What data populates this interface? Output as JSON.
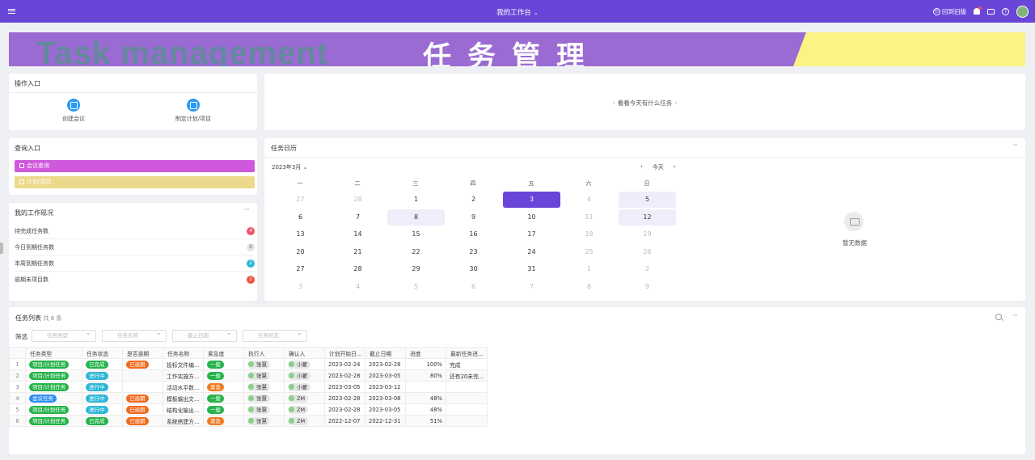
{
  "topbar": {
    "title": "我的工作台",
    "return_label": "回到旧版",
    "return_glyph": "©",
    "chevron": "⌄",
    "help_glyph": "?"
  },
  "banner": {
    "en_text": "Task management",
    "cn_text": "任务管理"
  },
  "ops": {
    "title": "操作入口",
    "items": [
      {
        "label": "创建会议"
      },
      {
        "label": "制定计划/项目"
      }
    ]
  },
  "today": {
    "text": "◦ 看看今天有什么任务 ◦"
  },
  "query": {
    "title": "查询入口",
    "items": [
      {
        "label": "会议查询",
        "color": "#cf59dd"
      },
      {
        "label": "计划/项目",
        "color": "#ecd98b"
      }
    ]
  },
  "workstatus": {
    "title": "我的工作现况",
    "rows": [
      {
        "label": "待完成任务数",
        "count": "4",
        "color": "#f0526a"
      },
      {
        "label": "今日到期任务数",
        "count": "0",
        "color": "#e4e4e4"
      },
      {
        "label": "本周到期任务数",
        "count": "2",
        "color": "#2bb7d6"
      },
      {
        "label": "逾期未项目数",
        "count": "2",
        "color": "#f0513e"
      }
    ]
  },
  "calendar": {
    "title": "任务日历",
    "month": "2023年3月",
    "month_chevron": "⌄",
    "prev_arrow": "‹",
    "next_arrow": "›",
    "today_label": "今天",
    "weekdays": [
      "一",
      "二",
      "三",
      "四",
      "五",
      "六",
      "日"
    ],
    "weeks": [
      [
        [
          "27",
          "o"
        ],
        [
          "28",
          "o"
        ],
        [
          "1",
          ""
        ],
        [
          "2",
          ""
        ],
        [
          "3",
          "today"
        ],
        [
          "4",
          "o"
        ],
        [
          "5",
          "wkd"
        ]
      ],
      [
        [
          "6",
          ""
        ],
        [
          "7",
          ""
        ],
        [
          "8",
          "wkd"
        ],
        [
          "9",
          ""
        ],
        [
          "10",
          ""
        ],
        [
          "11",
          "o"
        ],
        [
          "12",
          "wkd"
        ]
      ],
      [
        [
          "13",
          ""
        ],
        [
          "14",
          ""
        ],
        [
          "15",
          ""
        ],
        [
          "16",
          ""
        ],
        [
          "17",
          ""
        ],
        [
          "18",
          "o"
        ],
        [
          "19",
          "o"
        ]
      ],
      [
        [
          "20",
          ""
        ],
        [
          "21",
          ""
        ],
        [
          "22",
          ""
        ],
        [
          "23",
          ""
        ],
        [
          "24",
          ""
        ],
        [
          "25",
          "o"
        ],
        [
          "26",
          "o"
        ]
      ],
      [
        [
          "27",
          ""
        ],
        [
          "28",
          ""
        ],
        [
          "29",
          ""
        ],
        [
          "30",
          ""
        ],
        [
          "31",
          ""
        ],
        [
          "1",
          "o"
        ],
        [
          "2",
          "o"
        ]
      ],
      [
        [
          "3",
          "o"
        ],
        [
          "4",
          "o"
        ],
        [
          "5",
          "o"
        ],
        [
          "6",
          "o"
        ],
        [
          "7",
          "o"
        ],
        [
          "8",
          "o"
        ],
        [
          "9",
          "o"
        ]
      ]
    ],
    "empty_text": "暂无数据"
  },
  "tasklist": {
    "title": "任务列表",
    "count_text": "共 6 条",
    "filter_label": "筛选",
    "filters": [
      "任务类型",
      "任务名称",
      "截止日期",
      "任务状态"
    ],
    "columns": [
      "任务类型",
      "任务状态",
      "是否逾期",
      "任务名称",
      "紧急度",
      "执行人",
      "确认人",
      "计划开始日...",
      "截止日期",
      "进度",
      "最新任务进..."
    ],
    "rows": [
      {
        "n": "1",
        "type": "项目/计划任务",
        "type_c": "#26b34a",
        "status": "已完成",
        "status_c": "#26b34a",
        "overdue": "已逾期",
        "name": "投标文件编...",
        "urg": "一般",
        "urg_c": "#26b34a",
        "exec": "张慧",
        "exec_c": "#8ccf8a",
        "conf": "小翟",
        "conf_c": "#8ccf8a",
        "start": "2023-02-24",
        "end": "2023-02-28",
        "prog": "100%",
        "latest": "完成"
      },
      {
        "n": "2",
        "type": "项目/计划任务",
        "type_c": "#26b34a",
        "status": "进行中",
        "status_c": "#2bb7d6",
        "overdue": "",
        "name": "工作实施方...",
        "urg": "一般",
        "urg_c": "#26b34a",
        "exec": "张慧",
        "exec_c": "#8ccf8a",
        "conf": "小翟",
        "conf_c": "#8ccf8a",
        "start": "2023-02-28",
        "end": "2023-03-05",
        "prog": "80%",
        "latest": "还有20未完..."
      },
      {
        "n": "3",
        "type": "项目/计划任务",
        "type_c": "#26b34a",
        "status": "进行中",
        "status_c": "#2bb7d6",
        "overdue": "",
        "name": "活动水平数...",
        "urg": "紧急",
        "urg_c": "#f07a20",
        "exec": "张慧",
        "exec_c": "#8ccf8a",
        "conf": "小翟",
        "conf_c": "#8ccf8a",
        "start": "2023-03-05",
        "end": "2023-03-12",
        "prog": "",
        "latest": ""
      },
      {
        "n": "4",
        "type": "会议任务",
        "type_c": "#2d8ff2",
        "status": "进行中",
        "status_c": "#2bb7d6",
        "overdue": "已逾期",
        "name": "模板输出文...",
        "urg": "一般",
        "urg_c": "#26b34a",
        "exec": "张慧",
        "exec_c": "#8ccf8a",
        "conf": "ZM",
        "conf_c": "#8ccf8a",
        "start": "2023-02-28",
        "end": "2023-03-08",
        "prog": "48%",
        "latest": ""
      },
      {
        "n": "5",
        "type": "项目/计划任务",
        "type_c": "#26b34a",
        "status": "进行中",
        "status_c": "#2bb7d6",
        "overdue": "已逾期",
        "name": "结构化输出...",
        "urg": "一般",
        "urg_c": "#26b34a",
        "exec": "张慧",
        "exec_c": "#8ccf8a",
        "conf": "ZM",
        "conf_c": "#8ccf8a",
        "start": "2023-02-28",
        "end": "2023-03-05",
        "prog": "48%",
        "latest": ""
      },
      {
        "n": "6",
        "type": "项目/计划任务",
        "type_c": "#26b34a",
        "status": "已完成",
        "status_c": "#26b34a",
        "overdue": "已逾期",
        "name": "系统搭建方...",
        "urg": "紧急",
        "urg_c": "#f07a20",
        "exec": "张慧",
        "exec_c": "#8ccf8a",
        "conf": "ZM",
        "conf_c": "#8ccf8a",
        "start": "2022-12-07",
        "end": "2022-12-31",
        "prog": "51%",
        "latest": ""
      }
    ],
    "overdue_color": "#f06a1e"
  }
}
